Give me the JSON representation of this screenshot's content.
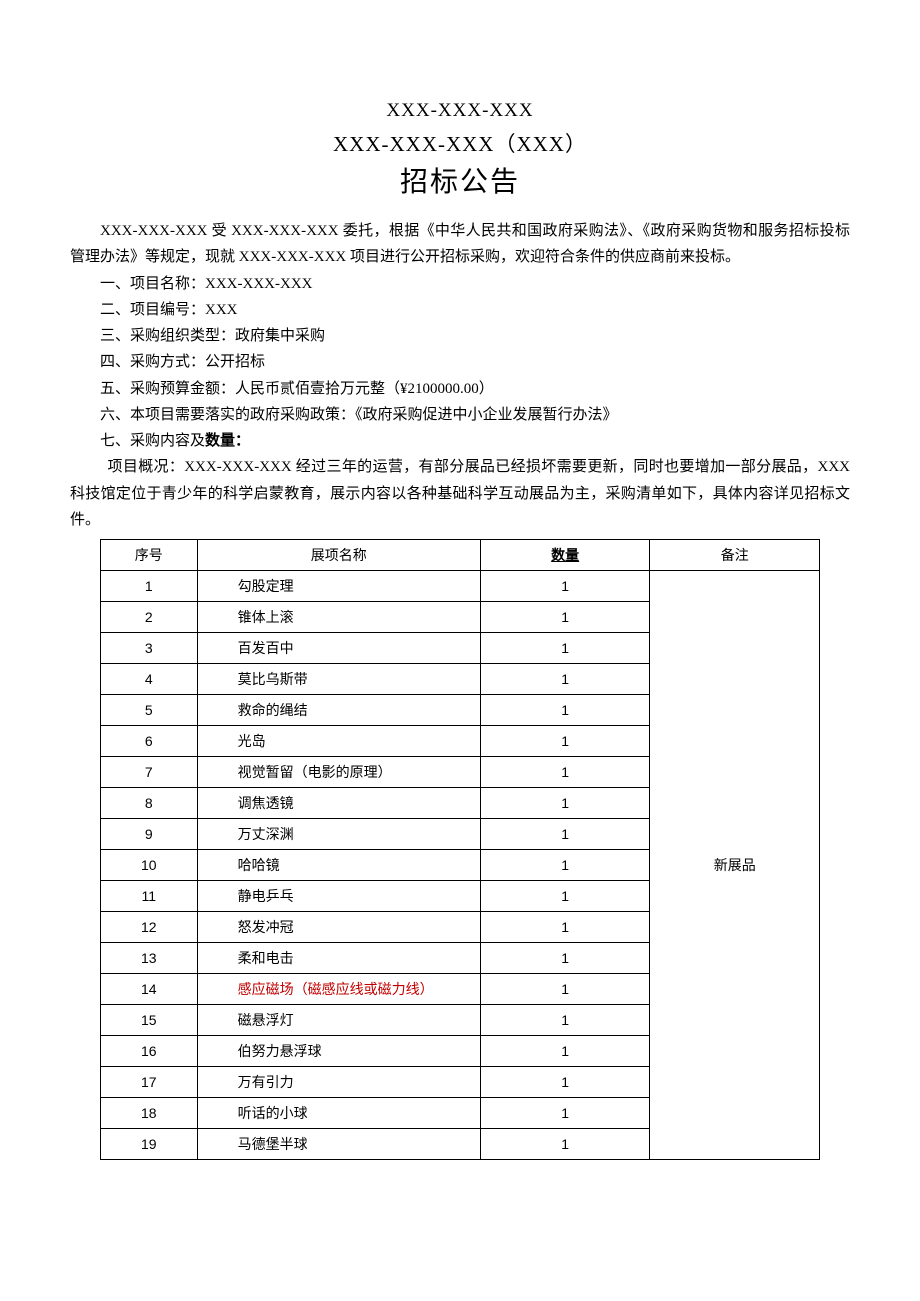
{
  "header": {
    "code": "XXX-XXX-XXX",
    "sub": "XXX-XXX-XXX（XXX）",
    "title": "招标公告"
  },
  "intro": "XXX-XXX-XXX 受 XXX-XXX-XXX 委托，根据《中华人民共和国政府采购法》、《政府采购货物和服务招标投标管理办法》等规定，现就 XXX-XXX-XXX 项目进行公开招标采购，欢迎符合条件的供应商前来投标。",
  "items": {
    "one": "一、项目名称：XXX-XXX-XXX",
    "two": "二、项目编号：XXX",
    "three": "三、采购组织类型：政府集中采购",
    "four": "四、采购方式：公开招标",
    "five": "五、采购预算金额：人民币贰佰壹拾万元整（¥2100000.00）",
    "six": "六、本项目需要落实的政府采购政策：《政府采购促进中小企业发展暂行办法》",
    "seven_label": "七、采购内容及",
    "seven_bold": "数量：",
    "overview": "项目概况：XXX-XXX-XXX 经过三年的运营，有部分展品已经损坏需要更新，同时也要增加一部分展品，XXX科技馆定位于青少年的科学启蒙教育，展示内容以各种基础科学互动展品为主，采购清单如下，具体内容详见招标文件。"
  },
  "table": {
    "headers": {
      "seq": "序号",
      "name": "展项名称",
      "qty": "数量",
      "note": "备注"
    },
    "note_text": "新展品",
    "rows": [
      {
        "seq": "1",
        "name": "勾股定理",
        "qty": "1",
        "red": false
      },
      {
        "seq": "2",
        "name": "锥体上滚",
        "qty": "1",
        "red": false
      },
      {
        "seq": "3",
        "name": "百发百中",
        "qty": "1",
        "red": false
      },
      {
        "seq": "4",
        "name": "莫比乌斯带",
        "qty": "1",
        "red": false
      },
      {
        "seq": "5",
        "name": "救命的绳结",
        "qty": "1",
        "red": false
      },
      {
        "seq": "6",
        "name": "光岛",
        "qty": "1",
        "red": false
      },
      {
        "seq": "7",
        "name": "视觉暂留（电影的原理）",
        "qty": "1",
        "red": false
      },
      {
        "seq": "8",
        "name": "调焦透镜",
        "qty": "1",
        "red": false
      },
      {
        "seq": "9",
        "name": "万丈深渊",
        "qty": "1",
        "red": false
      },
      {
        "seq": "10",
        "name": "哈哈镜",
        "qty": "1",
        "red": false
      },
      {
        "seq": "11",
        "name": "静电乒乓",
        "qty": "1",
        "red": false
      },
      {
        "seq": "12",
        "name": "怒发冲冠",
        "qty": "1",
        "red": false
      },
      {
        "seq": "13",
        "name": "柔和电击",
        "qty": "1",
        "red": false
      },
      {
        "seq": "14",
        "name": "感应磁场（磁感应线或磁力线）",
        "qty": "1",
        "red": true
      },
      {
        "seq": "15",
        "name": "磁悬浮灯",
        "qty": "1",
        "red": false
      },
      {
        "seq": "16",
        "name": "伯努力悬浮球",
        "qty": "1",
        "red": false
      },
      {
        "seq": "17",
        "name": "万有引力",
        "qty": "1",
        "red": false
      },
      {
        "seq": "18",
        "name": "听话的小球",
        "qty": "1",
        "red": false
      },
      {
        "seq": "19",
        "name": "马德堡半球",
        "qty": "1",
        "red": false
      }
    ]
  }
}
